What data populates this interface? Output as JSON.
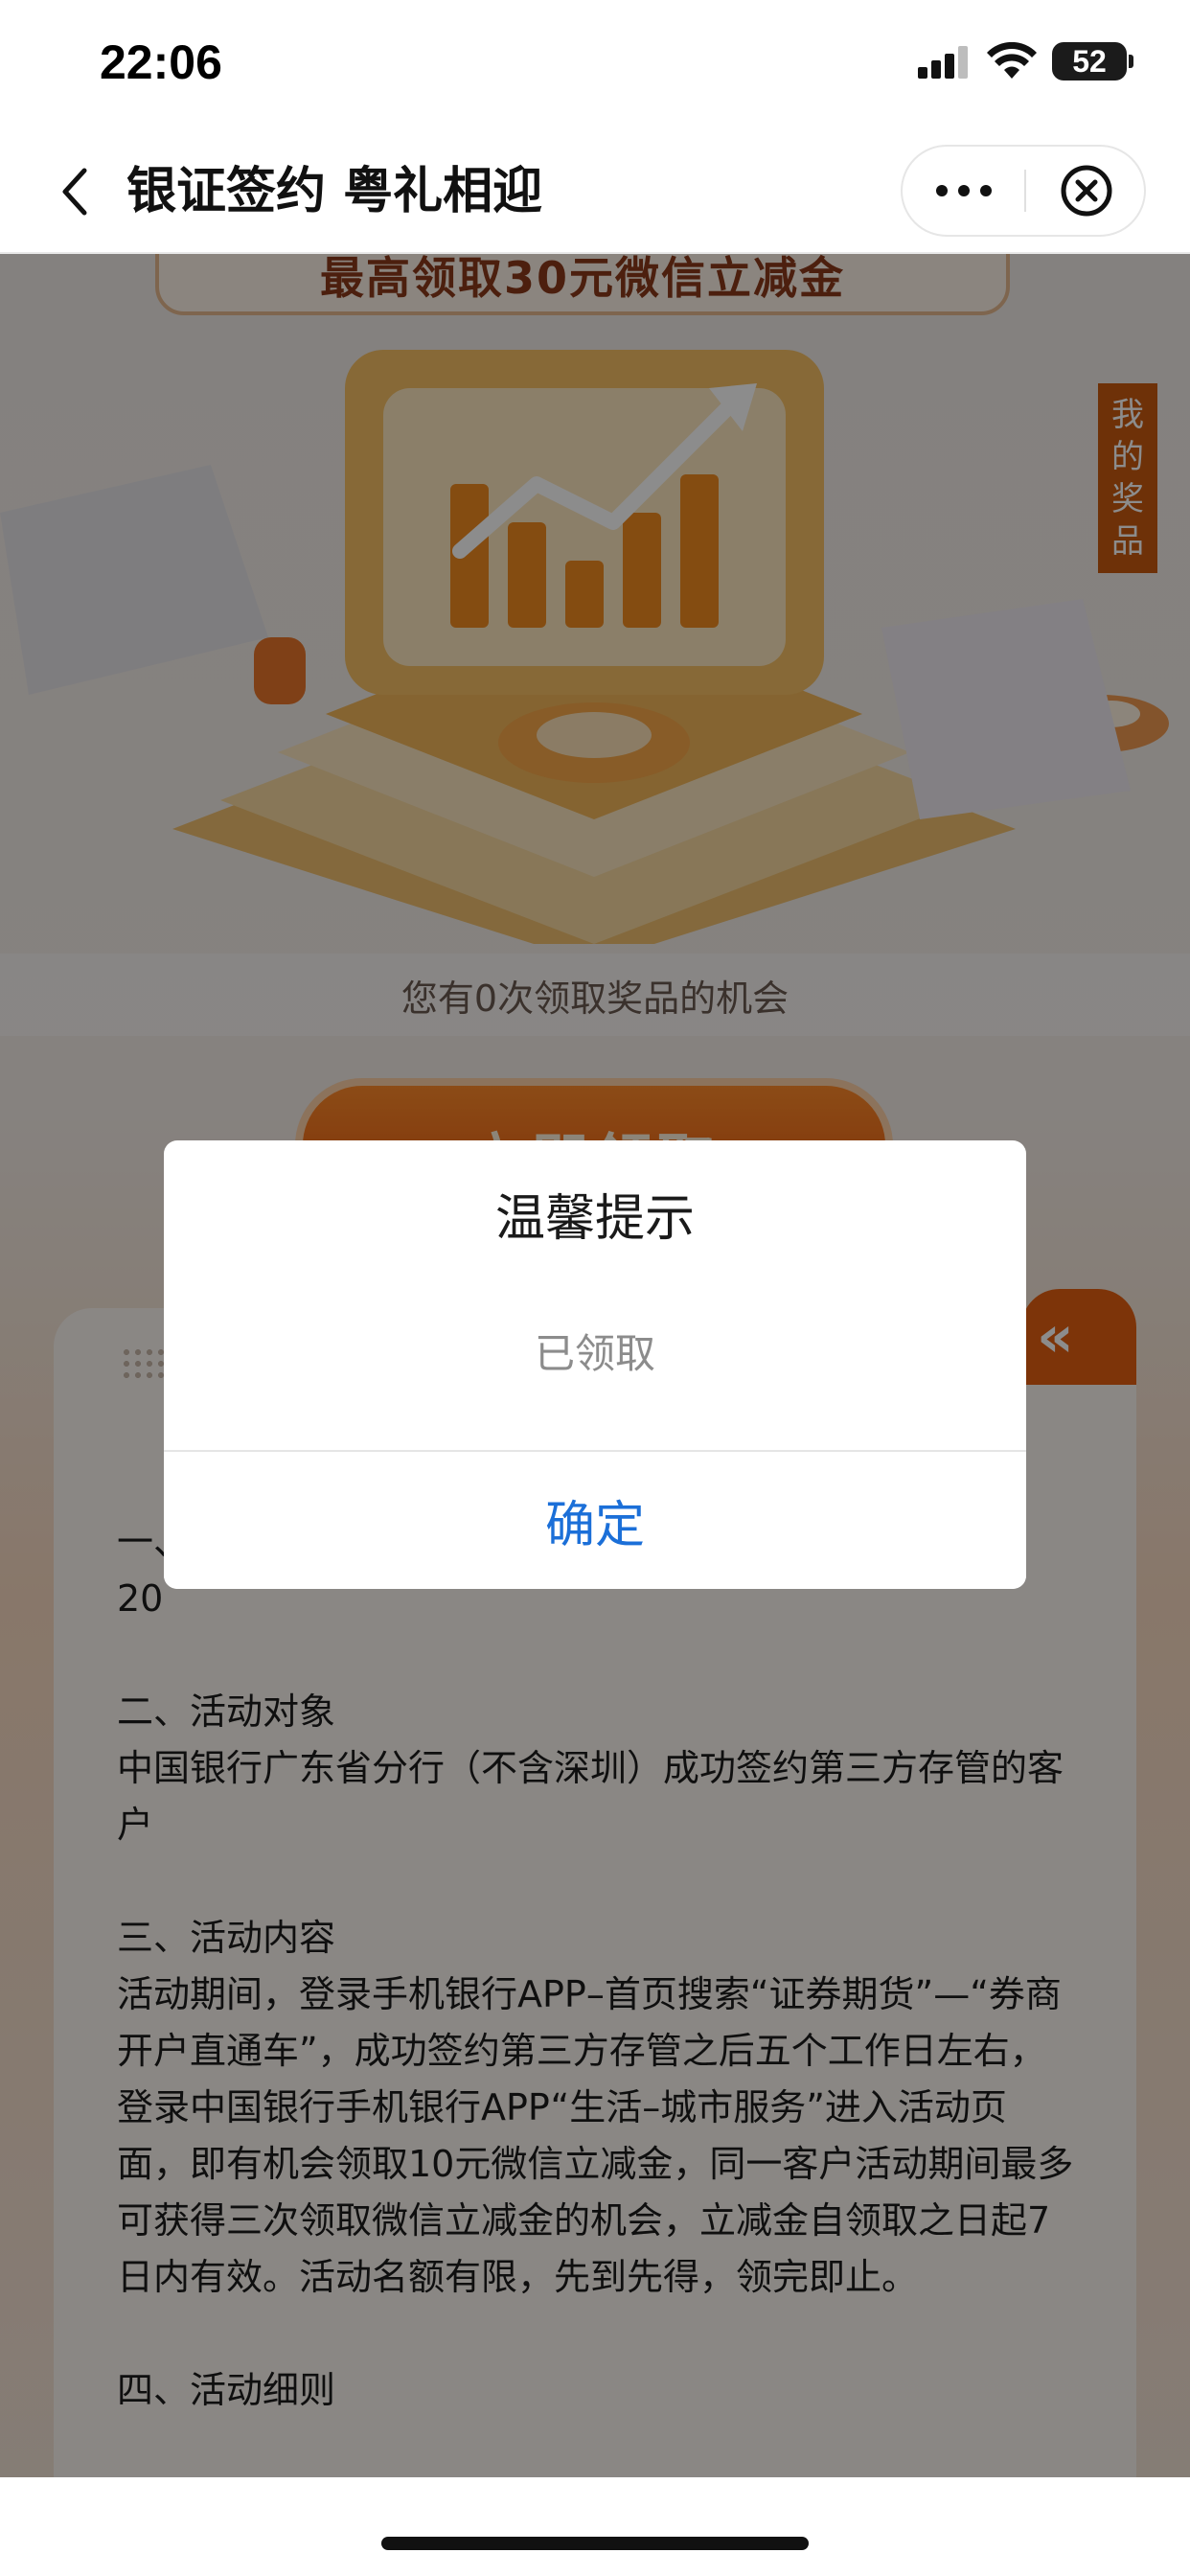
{
  "status_bar": {
    "time": "22:06",
    "battery": "52",
    "icons": [
      "signal-icon",
      "wifi-icon",
      "battery-icon"
    ]
  },
  "nav": {
    "title": "银证签约 粤礼相迎",
    "back_icon": "chevron-left-icon",
    "more_icon": "more-dots-icon",
    "close_icon": "close-circle-icon"
  },
  "page": {
    "hero_banner": "最高领取30元微信立减金",
    "my_prizes": "我的奖品",
    "chance_text": "您有0次领取奖品的机会",
    "claim_button": "立即领取",
    "rules": {
      "tab_icon": "«",
      "paragraphs": [
        "一、",
        "20",
        "",
        "二、活动对象",
        "中国银行广东省分行（不含深圳）成功签约第三方存管的客户",
        "",
        "三、活动内容",
        "活动期间，登录手机银行APP–首页搜索“证券期货”—“券商开户直通车”，成功签约第三方存管之后五个工作日左右，登录中国银行手机银行APP“生活–城市服务”进入活动页面，即有机会领取10元微信立减金，同一客户活动期间最多可获得三次领取微信立减金的机会，立减金自领取之日起7日内有效。活动名额有限，先到先得，领完即止。",
        "",
        "四、活动细则"
      ]
    }
  },
  "dialog": {
    "title": "温馨提示",
    "message": "已领取",
    "confirm": "确定"
  },
  "colors": {
    "accent_orange": "#e45f11",
    "confirm_blue": "#1b6fd8",
    "overlay": "rgba(0,0,0,0.45)"
  }
}
